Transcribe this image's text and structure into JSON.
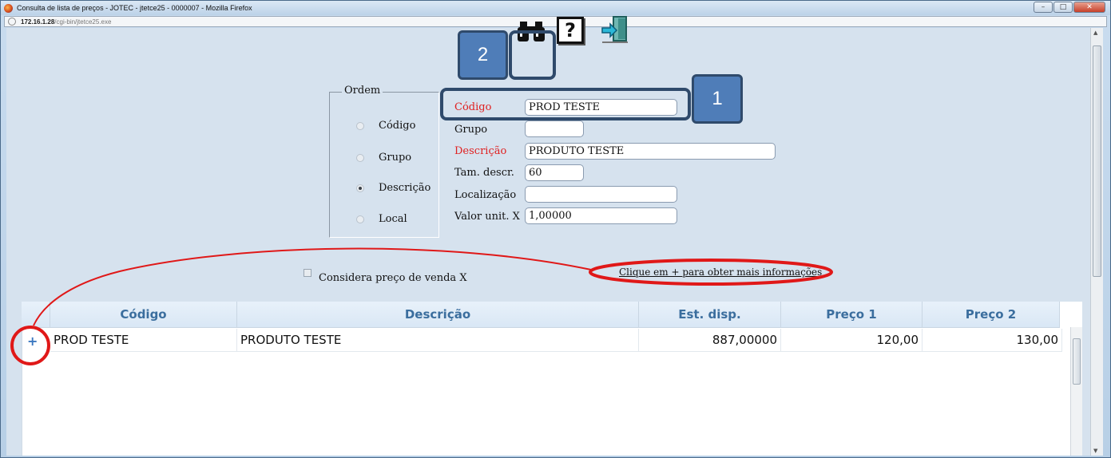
{
  "window": {
    "title": "Consulta de lista de preços - JOTEC - jtetce25 - 0000007 - Mozilla Firefox",
    "buttons": {
      "minimize": "–",
      "maximize": "□",
      "close": "✕"
    }
  },
  "address": {
    "host": "172.16.1.28",
    "path": "/cgi-bin/jtetce25.exe"
  },
  "toolbar": {
    "search_icon": "binoculars-icon",
    "help_icon": "help-icon",
    "help_glyph": "?",
    "exit_icon": "exit-door-icon"
  },
  "callouts": {
    "badge1": "1",
    "badge2": "2"
  },
  "order": {
    "legend": "Ordem",
    "options": [
      {
        "label": "Código",
        "selected": false
      },
      {
        "label": "Grupo",
        "selected": false
      },
      {
        "label": "Descrição",
        "selected": true
      },
      {
        "label": "Local",
        "selected": false
      }
    ]
  },
  "fields": {
    "codigo": {
      "label": "Código",
      "value": "PROD TESTE",
      "color": "#e02020"
    },
    "grupo": {
      "label": "Grupo",
      "value": ""
    },
    "descricao": {
      "label": "Descrição",
      "value": "PRODUTO TESTE",
      "color": "#e02020"
    },
    "tam_descr": {
      "label": "Tam. descr.",
      "value": "60"
    },
    "localizacao": {
      "label": "Localização",
      "value": ""
    },
    "valor_unit": {
      "label": "Valor unit. X",
      "value": "1,00000"
    }
  },
  "options": {
    "considera_label": "Considera preço de venda X",
    "considera_checked": false,
    "info_link": "Clique em + para obter mais informações"
  },
  "grid": {
    "columns": [
      "Código",
      "Descrição",
      "Est. disp.",
      "Preço 1",
      "Preço 2"
    ],
    "expand_glyph": "+",
    "rows": [
      {
        "codigo": "PROD TESTE",
        "descricao": "PRODUTO TESTE",
        "est_disp": "887,00000",
        "preco1": "120,00",
        "preco2": "130,00"
      }
    ]
  },
  "colors": {
    "annotation_red": "#e01818",
    "callout_blue": "#4f7db8",
    "header_text": "#3b6e9e"
  }
}
